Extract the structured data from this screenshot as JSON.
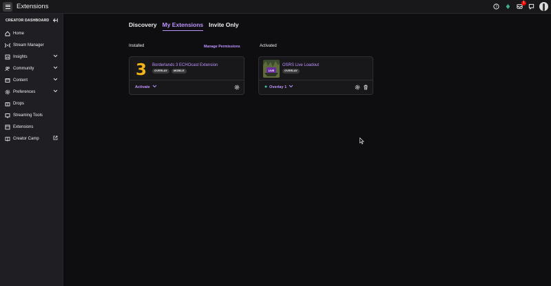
{
  "app": {
    "title": "Extensions",
    "notification_count": "1"
  },
  "sidebar": {
    "header": "CREATOR DASHBOARD",
    "items": [
      {
        "label": "Home"
      },
      {
        "label": "Stream Manager"
      },
      {
        "label": "Insights"
      },
      {
        "label": "Community"
      },
      {
        "label": "Content"
      },
      {
        "label": "Preferences"
      },
      {
        "label": "Drops"
      },
      {
        "label": "Streaming Tools"
      },
      {
        "label": "Extensions"
      },
      {
        "label": "Creator Camp"
      }
    ]
  },
  "tabs": [
    {
      "label": "Discovery"
    },
    {
      "label": "My Extensions"
    },
    {
      "label": "Invite Only"
    }
  ],
  "installed": {
    "label": "Installed",
    "manage_label": "Manage Permissions",
    "card": {
      "name": "Borderlands 3 ECHOcast Extension",
      "tags": [
        "OVERLAY",
        "MOBILE"
      ],
      "action_label": "Activate"
    }
  },
  "activated": {
    "label": "Activated",
    "card": {
      "name": "OSRS Live Loadout",
      "tags": [
        "OVERLAY"
      ],
      "action_label": "Overlay 1"
    }
  },
  "colors": {
    "accent": "#bf94ff",
    "background": "#0e0e10",
    "sidebar": "#1f1f23"
  }
}
